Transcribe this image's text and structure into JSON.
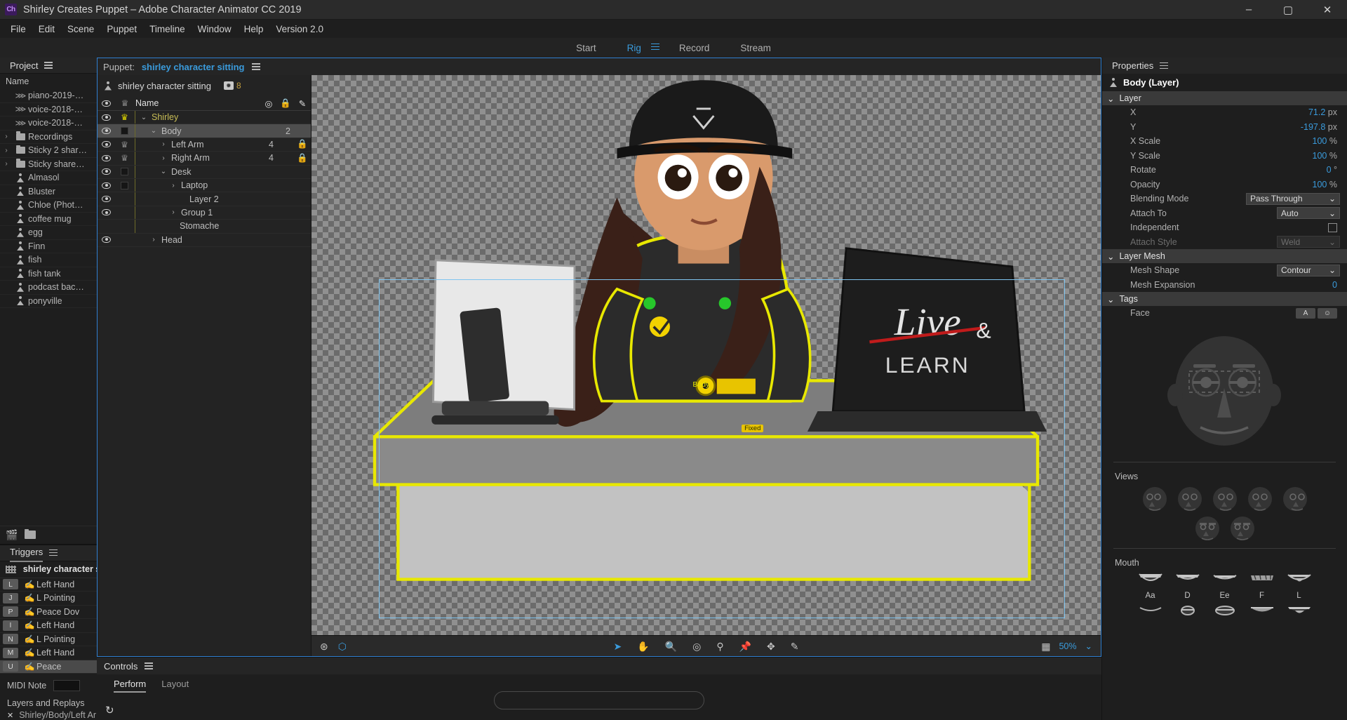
{
  "window": {
    "title": "Shirley Creates Puppet – Adobe Character Animator CC 2019",
    "logo": "Ch",
    "minimize": "–",
    "maximize": "▢",
    "close": "✕"
  },
  "menubar": {
    "items": [
      "File",
      "Edit",
      "Scene",
      "Puppet",
      "Timeline",
      "Window",
      "Help",
      "Version 2.0"
    ]
  },
  "modebar": {
    "modes": [
      "Start",
      "Rig",
      "Record",
      "Stream"
    ],
    "active": "Rig"
  },
  "project": {
    "title": "Project",
    "column_header": "Name",
    "items": [
      {
        "icon": "audio-waveform-icon",
        "label": "piano-2019-…",
        "twirl": ""
      },
      {
        "icon": "audio-waveform-icon",
        "label": "voice-2018-…",
        "twirl": ""
      },
      {
        "icon": "audio-waveform-icon",
        "label": "voice-2018-…",
        "twirl": ""
      },
      {
        "icon": "folder-icon",
        "label": "Recordings",
        "twirl": "›"
      },
      {
        "icon": "folder-icon",
        "label": "Sticky 2 shar…",
        "twirl": "›"
      },
      {
        "icon": "folder-icon",
        "label": "Sticky share…",
        "twirl": "›"
      },
      {
        "icon": "puppet-icon",
        "label": "Almasol",
        "twirl": ""
      },
      {
        "icon": "puppet-icon",
        "label": "Bluster",
        "twirl": ""
      },
      {
        "icon": "puppet-icon",
        "label": "Chloe (Phot…",
        "twirl": ""
      },
      {
        "icon": "puppet-icon",
        "label": "coffee mug",
        "twirl": ""
      },
      {
        "icon": "puppet-icon",
        "label": "egg",
        "twirl": ""
      },
      {
        "icon": "puppet-icon",
        "label": "Finn",
        "twirl": ""
      },
      {
        "icon": "puppet-icon",
        "label": "fish",
        "twirl": ""
      },
      {
        "icon": "puppet-icon",
        "label": "fish tank",
        "twirl": ""
      },
      {
        "icon": "puppet-icon",
        "label": "podcast bac…",
        "twirl": ""
      },
      {
        "icon": "puppet-icon",
        "label": "ponyville",
        "twirl": ""
      }
    ]
  },
  "triggers": {
    "title": "Triggers",
    "puppet_name": "shirley character si",
    "rows": [
      {
        "key": "L",
        "label": "Left Hand",
        "selected": false
      },
      {
        "key": "J",
        "label": "L Pointing",
        "selected": false
      },
      {
        "key": "P",
        "label": "Peace Dov",
        "selected": false
      },
      {
        "key": "I",
        "label": "Left Hand",
        "selected": false
      },
      {
        "key": "N",
        "label": "L Pointing",
        "selected": false
      },
      {
        "key": "M",
        "label": "Left Hand",
        "selected": false
      },
      {
        "key": "U",
        "label": "Peace",
        "selected": true
      }
    ],
    "midi_label": "MIDI Note",
    "midi_value": "",
    "layers_replays_label": "Layers and Replays",
    "layers_replays_item": "Shirley/Body/Left Ar"
  },
  "puppet_panel": {
    "prefix": "Puppet:",
    "name": "shirley character sitting",
    "root_name": "shirley character sitting",
    "camera_count": "8",
    "column_header": "Name",
    "layers": [
      {
        "name": "Shirley",
        "indent": 0,
        "twirl": "⌄",
        "tag": "crown-gold",
        "gold": true,
        "num": "",
        "selected": false
      },
      {
        "name": "Body",
        "indent": 1,
        "twirl": "⌄",
        "tag": "square",
        "gold": false,
        "num": "2",
        "selected": true
      },
      {
        "name": "Left Arm",
        "indent": 2,
        "twirl": "›",
        "tag": "crown-grey",
        "gold": false,
        "num": "4",
        "selected": false
      },
      {
        "name": "Right Arm",
        "indent": 2,
        "twirl": "›",
        "tag": "crown-grey",
        "gold": false,
        "num": "4",
        "selected": false
      },
      {
        "name": "Desk",
        "indent": 2,
        "twirl": "⌄",
        "tag": "square",
        "gold": false,
        "num": "",
        "selected": false
      },
      {
        "name": "Laptop",
        "indent": 3,
        "twirl": "›",
        "tag": "square",
        "gold": false,
        "num": "",
        "selected": false
      },
      {
        "name": "Layer 2",
        "indent": 3,
        "twirl": "",
        "tag": "none",
        "gold": false,
        "num": "",
        "selected": false
      },
      {
        "name": "Group 1",
        "indent": 3,
        "twirl": "›",
        "tag": "none",
        "gold": false,
        "num": "",
        "selected": false
      },
      {
        "name": "Stomache",
        "indent": 2,
        "twirl": "",
        "tag": "none",
        "gold": false,
        "num": "",
        "selected": false
      },
      {
        "name": "Head",
        "indent": 1,
        "twirl": "›",
        "tag": "none",
        "gold": false,
        "num": "",
        "selected": false
      }
    ]
  },
  "canvas": {
    "tools": [
      "select-arrow-icon",
      "hand-icon",
      "zoom-icon",
      "origin-icon",
      "handle-icon",
      "pin-icon",
      "dragger-icon",
      "draw-icon"
    ],
    "left_icons": [
      "mesh-icon",
      "outline-icon"
    ],
    "right_icons": [
      "checker-icon"
    ],
    "zoom_level": "50%",
    "zoom_caret": "⌄",
    "overlay_body_label": "Body",
    "overlay_fixed_label": "Fixed"
  },
  "controls": {
    "title": "Controls",
    "tabs": [
      "Perform",
      "Layout"
    ],
    "active_tab": "Perform",
    "refresh_icon": "refresh-icon"
  },
  "properties": {
    "title": "Properties",
    "object": "Body (Layer)",
    "sections": [
      {
        "name": "Layer",
        "rows": [
          {
            "label": "X",
            "value": "71.2",
            "unit": "px",
            "type": "number"
          },
          {
            "label": "Y",
            "value": "-197.8",
            "unit": "px",
            "type": "number"
          },
          {
            "label": "X Scale",
            "value": "100",
            "unit": "%",
            "type": "number"
          },
          {
            "label": "Y Scale",
            "value": "100",
            "unit": "%",
            "type": "number"
          },
          {
            "label": "Rotate",
            "value": "0",
            "unit": "°",
            "type": "number"
          },
          {
            "label": "Opacity",
            "value": "100",
            "unit": "%",
            "type": "number"
          },
          {
            "label": "Blending Mode",
            "value": "Pass Through",
            "unit": "",
            "type": "select-wide"
          },
          {
            "label": "Attach To",
            "value": "Auto",
            "unit": "",
            "type": "select"
          },
          {
            "label": "Independent",
            "value": "",
            "unit": "",
            "type": "checkbox"
          },
          {
            "label": "Attach Style",
            "value": "Weld",
            "unit": "",
            "type": "select-dim",
            "dim": true
          }
        ]
      },
      {
        "name": "Layer Mesh",
        "rows": [
          {
            "label": "Mesh Shape",
            "value": "Contour",
            "unit": "",
            "type": "select"
          },
          {
            "label": "Mesh Expansion",
            "value": "0",
            "unit": "",
            "type": "number"
          }
        ]
      },
      {
        "name": "Tags",
        "rows": [
          {
            "label": "Face",
            "value": "",
            "unit": "",
            "type": "tagbuttons",
            "buttons": [
              "A",
              "☺"
            ]
          }
        ]
      }
    ],
    "views_label": "Views",
    "views_count_row1": 5,
    "views_count_row2": 2,
    "mouth_label": "Mouth",
    "mouth_visemes": [
      "Aa",
      "D",
      "Ee",
      "F",
      "L"
    ]
  }
}
